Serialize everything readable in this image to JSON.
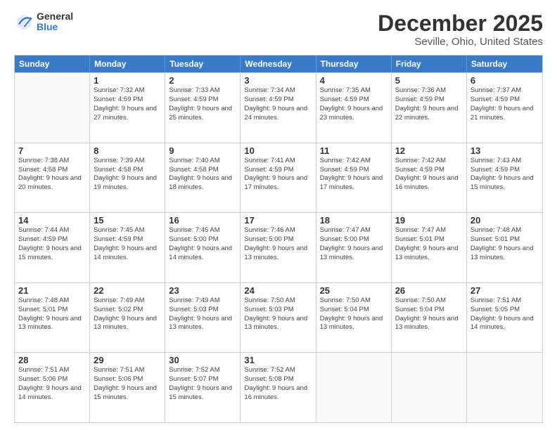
{
  "logo": {
    "general": "General",
    "blue": "Blue"
  },
  "header": {
    "title": "December 2025",
    "subtitle": "Seville, Ohio, United States"
  },
  "weekdays": [
    "Sunday",
    "Monday",
    "Tuesday",
    "Wednesday",
    "Thursday",
    "Friday",
    "Saturday"
  ],
  "weeks": [
    [
      {
        "day": "",
        "sunrise": "",
        "sunset": "",
        "daylight": ""
      },
      {
        "day": "1",
        "sunrise": "Sunrise: 7:32 AM",
        "sunset": "Sunset: 4:59 PM",
        "daylight": "Daylight: 9 hours and 27 minutes."
      },
      {
        "day": "2",
        "sunrise": "Sunrise: 7:33 AM",
        "sunset": "Sunset: 4:59 PM",
        "daylight": "Daylight: 9 hours and 25 minutes."
      },
      {
        "day": "3",
        "sunrise": "Sunrise: 7:34 AM",
        "sunset": "Sunset: 4:59 PM",
        "daylight": "Daylight: 9 hours and 24 minutes."
      },
      {
        "day": "4",
        "sunrise": "Sunrise: 7:35 AM",
        "sunset": "Sunset: 4:59 PM",
        "daylight": "Daylight: 9 hours and 23 minutes."
      },
      {
        "day": "5",
        "sunrise": "Sunrise: 7:36 AM",
        "sunset": "Sunset: 4:59 PM",
        "daylight": "Daylight: 9 hours and 22 minutes."
      },
      {
        "day": "6",
        "sunrise": "Sunrise: 7:37 AM",
        "sunset": "Sunset: 4:59 PM",
        "daylight": "Daylight: 9 hours and 21 minutes."
      }
    ],
    [
      {
        "day": "7",
        "sunrise": "Sunrise: 7:38 AM",
        "sunset": "Sunset: 4:58 PM",
        "daylight": "Daylight: 9 hours and 20 minutes."
      },
      {
        "day": "8",
        "sunrise": "Sunrise: 7:39 AM",
        "sunset": "Sunset: 4:58 PM",
        "daylight": "Daylight: 9 hours and 19 minutes."
      },
      {
        "day": "9",
        "sunrise": "Sunrise: 7:40 AM",
        "sunset": "Sunset: 4:58 PM",
        "daylight": "Daylight: 9 hours and 18 minutes."
      },
      {
        "day": "10",
        "sunrise": "Sunrise: 7:41 AM",
        "sunset": "Sunset: 4:59 PM",
        "daylight": "Daylight: 9 hours and 17 minutes."
      },
      {
        "day": "11",
        "sunrise": "Sunrise: 7:42 AM",
        "sunset": "Sunset: 4:59 PM",
        "daylight": "Daylight: 9 hours and 17 minutes."
      },
      {
        "day": "12",
        "sunrise": "Sunrise: 7:42 AM",
        "sunset": "Sunset: 4:59 PM",
        "daylight": "Daylight: 9 hours and 16 minutes."
      },
      {
        "day": "13",
        "sunrise": "Sunrise: 7:43 AM",
        "sunset": "Sunset: 4:59 PM",
        "daylight": "Daylight: 9 hours and 15 minutes."
      }
    ],
    [
      {
        "day": "14",
        "sunrise": "Sunrise: 7:44 AM",
        "sunset": "Sunset: 4:59 PM",
        "daylight": "Daylight: 9 hours and 15 minutes."
      },
      {
        "day": "15",
        "sunrise": "Sunrise: 7:45 AM",
        "sunset": "Sunset: 4:59 PM",
        "daylight": "Daylight: 9 hours and 14 minutes."
      },
      {
        "day": "16",
        "sunrise": "Sunrise: 7:45 AM",
        "sunset": "Sunset: 5:00 PM",
        "daylight": "Daylight: 9 hours and 14 minutes."
      },
      {
        "day": "17",
        "sunrise": "Sunrise: 7:46 AM",
        "sunset": "Sunset: 5:00 PM",
        "daylight": "Daylight: 9 hours and 13 minutes."
      },
      {
        "day": "18",
        "sunrise": "Sunrise: 7:47 AM",
        "sunset": "Sunset: 5:00 PM",
        "daylight": "Daylight: 9 hours and 13 minutes."
      },
      {
        "day": "19",
        "sunrise": "Sunrise: 7:47 AM",
        "sunset": "Sunset: 5:01 PM",
        "daylight": "Daylight: 9 hours and 13 minutes."
      },
      {
        "day": "20",
        "sunrise": "Sunrise: 7:48 AM",
        "sunset": "Sunset: 5:01 PM",
        "daylight": "Daylight: 9 hours and 13 minutes."
      }
    ],
    [
      {
        "day": "21",
        "sunrise": "Sunrise: 7:48 AM",
        "sunset": "Sunset: 5:01 PM",
        "daylight": "Daylight: 9 hours and 13 minutes."
      },
      {
        "day": "22",
        "sunrise": "Sunrise: 7:49 AM",
        "sunset": "Sunset: 5:02 PM",
        "daylight": "Daylight: 9 hours and 13 minutes."
      },
      {
        "day": "23",
        "sunrise": "Sunrise: 7:49 AM",
        "sunset": "Sunset: 5:03 PM",
        "daylight": "Daylight: 9 hours and 13 minutes."
      },
      {
        "day": "24",
        "sunrise": "Sunrise: 7:50 AM",
        "sunset": "Sunset: 5:03 PM",
        "daylight": "Daylight: 9 hours and 13 minutes."
      },
      {
        "day": "25",
        "sunrise": "Sunrise: 7:50 AM",
        "sunset": "Sunset: 5:04 PM",
        "daylight": "Daylight: 9 hours and 13 minutes."
      },
      {
        "day": "26",
        "sunrise": "Sunrise: 7:50 AM",
        "sunset": "Sunset: 5:04 PM",
        "daylight": "Daylight: 9 hours and 13 minutes."
      },
      {
        "day": "27",
        "sunrise": "Sunrise: 7:51 AM",
        "sunset": "Sunset: 5:05 PM",
        "daylight": "Daylight: 9 hours and 14 minutes."
      }
    ],
    [
      {
        "day": "28",
        "sunrise": "Sunrise: 7:51 AM",
        "sunset": "Sunset: 5:06 PM",
        "daylight": "Daylight: 9 hours and 14 minutes."
      },
      {
        "day": "29",
        "sunrise": "Sunrise: 7:51 AM",
        "sunset": "Sunset: 5:06 PM",
        "daylight": "Daylight: 9 hours and 15 minutes."
      },
      {
        "day": "30",
        "sunrise": "Sunrise: 7:52 AM",
        "sunset": "Sunset: 5:07 PM",
        "daylight": "Daylight: 9 hours and 15 minutes."
      },
      {
        "day": "31",
        "sunrise": "Sunrise: 7:52 AM",
        "sunset": "Sunset: 5:08 PM",
        "daylight": "Daylight: 9 hours and 16 minutes."
      },
      {
        "day": "",
        "sunrise": "",
        "sunset": "",
        "daylight": ""
      },
      {
        "day": "",
        "sunrise": "",
        "sunset": "",
        "daylight": ""
      },
      {
        "day": "",
        "sunrise": "",
        "sunset": "",
        "daylight": ""
      }
    ]
  ]
}
